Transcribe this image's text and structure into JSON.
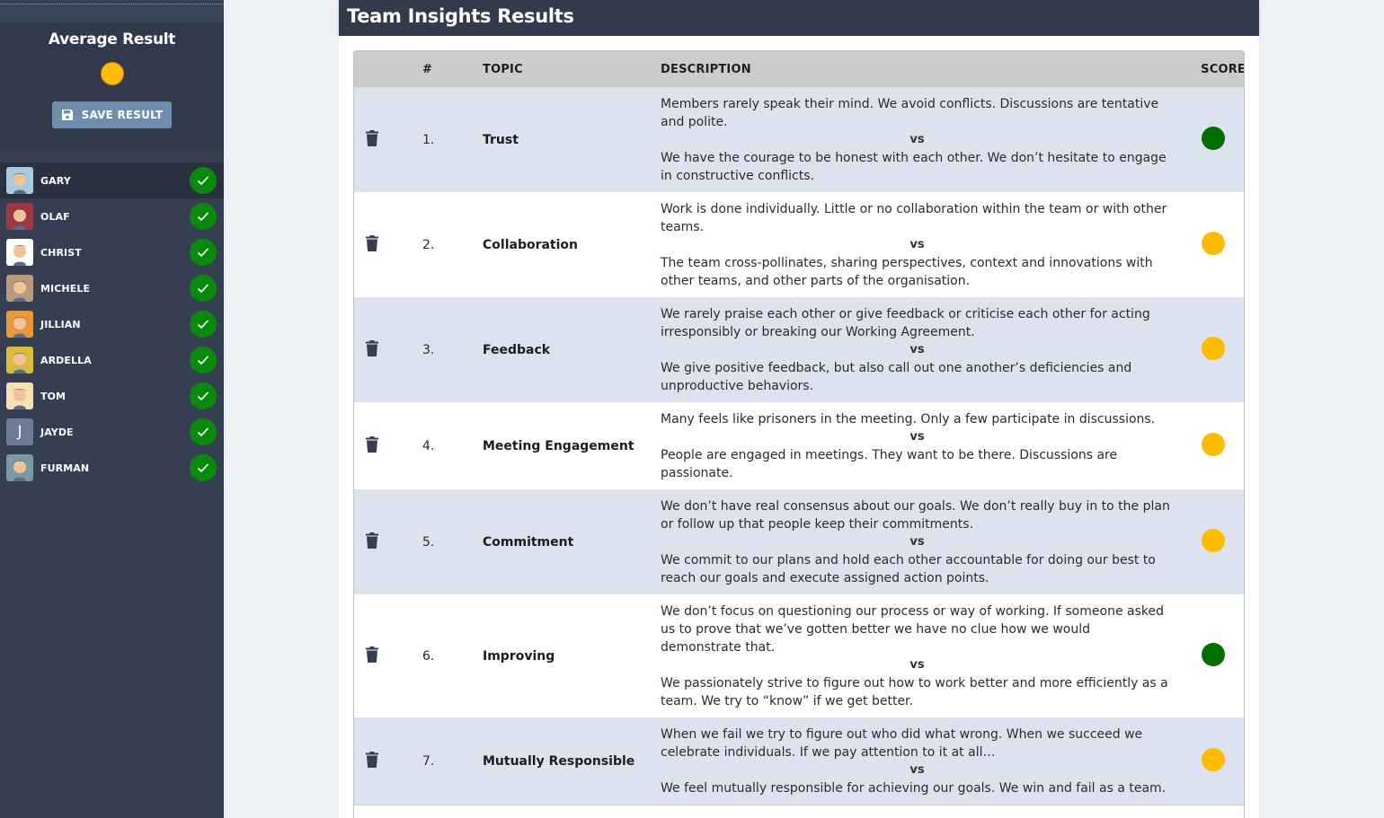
{
  "sidebar": {
    "average": {
      "title": "Average Result",
      "result_color": "#ffbb00",
      "result_level": "yellow"
    },
    "save_button": {
      "label": "SAVE RESULT",
      "icon": "floppy-disk-icon"
    },
    "users": [
      {
        "name": "GARY",
        "avatar": "avatar-woman-brown-hair",
        "avatar_bg": "#a9c9e2",
        "completed": true,
        "active": true
      },
      {
        "name": "OLAF",
        "avatar": "avatar-woman-dark-hair",
        "avatar_bg": "#9b3a44",
        "completed": true,
        "active": false
      },
      {
        "name": "CHRIST",
        "avatar": "avatar-woman-white-hair",
        "avatar_bg": "#ffffff",
        "completed": true,
        "active": false
      },
      {
        "name": "MICHELE",
        "avatar": "avatar-woman-red-hair",
        "avatar_bg": "#b99a80",
        "completed": true,
        "active": false
      },
      {
        "name": "JILLIAN",
        "avatar": "avatar-man-orange-bg",
        "avatar_bg": "#e8973a",
        "completed": true,
        "active": false
      },
      {
        "name": "ARDELLA",
        "avatar": "avatar-man-glasses-gray",
        "avatar_bg": "#d8bb3f",
        "completed": true,
        "active": false
      },
      {
        "name": "TOM",
        "avatar": "avatar-man-curly-hair",
        "avatar_bg": "#f6dfb6",
        "completed": true,
        "active": false
      },
      {
        "name": "JAYDE",
        "avatar": "initial-avatar",
        "avatar_initial": "J",
        "avatar_bg": "#6d7b96",
        "completed": true,
        "active": false
      },
      {
        "name": "FURMAN",
        "avatar": "avatar-man-glasses-headset",
        "avatar_bg": "#7b9aa3",
        "completed": true,
        "active": false
      }
    ]
  },
  "main": {
    "title": "Team Insights Results",
    "columns": {
      "num": "#",
      "topic": "TOPIC",
      "description": "DESCRIPTION",
      "score": "SCORE"
    },
    "vs_label": "vs",
    "colors": {
      "green": "#006e00",
      "yellow": "#ffbb00"
    },
    "rows": [
      {
        "num": "1.",
        "topic": "Trust",
        "negative": "Members rarely speak their mind. We avoid conflicts. Discussions are tentative and polite.",
        "positive": "We have the courage to be honest with each other. We don’t hesitate to engage in constructive conflicts.",
        "score": "green"
      },
      {
        "num": "2.",
        "topic": "Collaboration",
        "negative": "Work is done individually. Little or no collaboration within the team or with other teams.",
        "positive": "The team cross-pollinates, sharing perspectives, context and innovations with other teams, and other parts of the organisation.",
        "score": "yellow"
      },
      {
        "num": "3.",
        "topic": "Feedback",
        "negative": "We rarely praise each other or give feedback or criticise each other for acting irresponsibly or breaking our Working Agreement.",
        "positive": "We give positive feedback, but also call out one another’s deficiencies and unproductive behaviors.",
        "score": "yellow"
      },
      {
        "num": "4.",
        "topic": "Meeting Engagement",
        "negative": "Many feels like prisoners in the meeting. Only a few participate in discussions.",
        "positive": "People are engaged in meetings. They want to be there. Discussions are passionate.",
        "score": "yellow"
      },
      {
        "num": "5.",
        "topic": "Commitment",
        "negative": "We don’t have real consensus about our goals. We don’t really buy in to the plan or follow up that people keep their commitments.",
        "positive": "We commit to our plans and hold each other accountable for doing our best to reach our goals and execute assigned action points.",
        "score": "yellow"
      },
      {
        "num": "6.",
        "topic": "Improving",
        "negative": "We don’t focus on questioning our process or way of working. If someone asked us to prove that we’ve gotten better we have no clue how we would demonstrate that.",
        "positive": "We passionately strive to figure out how to work better and more efficiently as a team. We try to “know” if we get better.",
        "score": "green"
      },
      {
        "num": "7.",
        "topic": "Mutually Responsible",
        "negative": "When we fail we try to figure out who did what wrong. When we succeed we celebrate individuals. If we pay attention to it at all…",
        "positive": "We feel mutually responsible for achieving our goals. We win and fail as a team.",
        "score": "yellow"
      }
    ]
  }
}
